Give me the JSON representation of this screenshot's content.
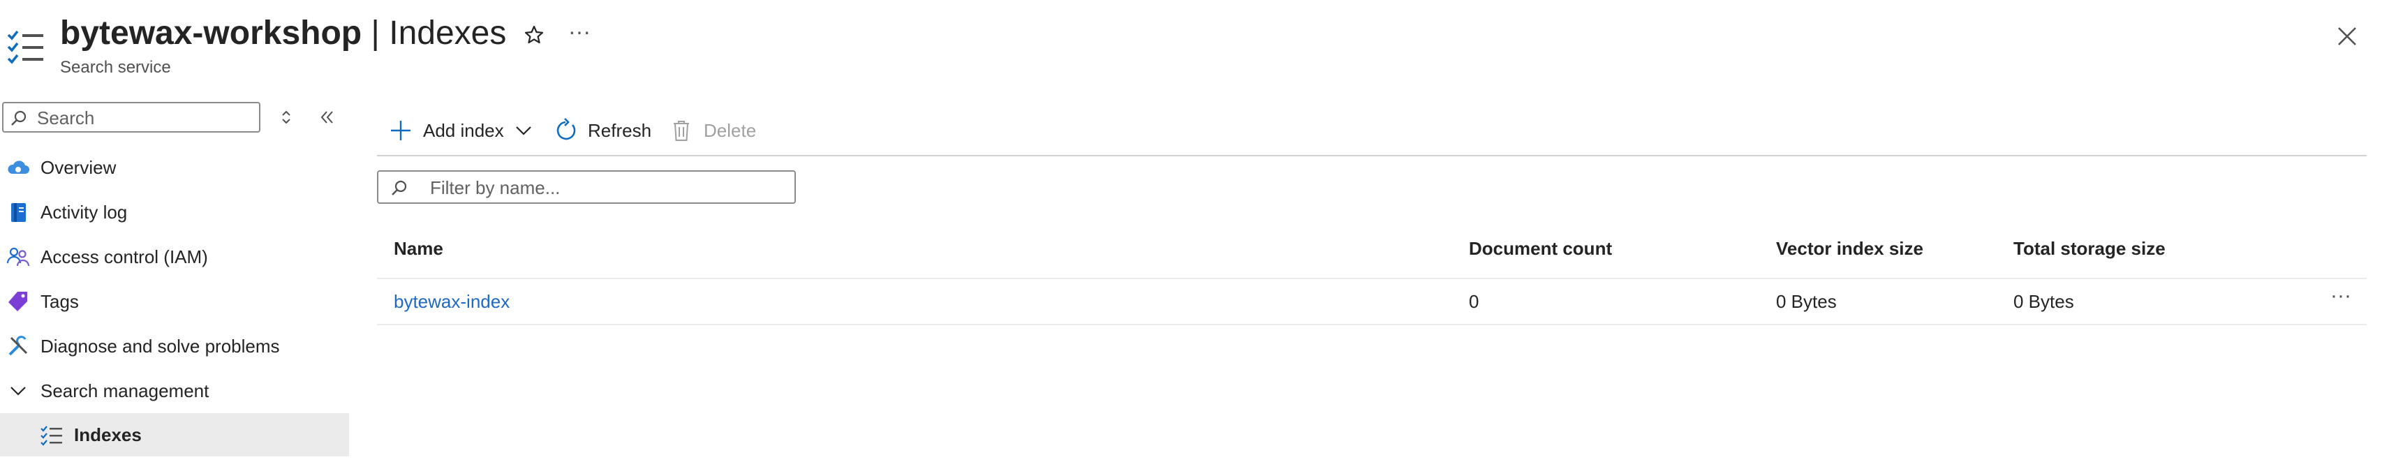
{
  "header": {
    "resource_name": "bytewax-workshop",
    "separator": " | ",
    "page_name": "Indexes",
    "subtitle": "Search service",
    "more_label": "···"
  },
  "sidebar": {
    "search_placeholder": "Search",
    "items": [
      {
        "label": "Overview",
        "icon": "cloud-overview-icon"
      },
      {
        "label": "Activity log",
        "icon": "activity-log-icon"
      },
      {
        "label": "Access control (IAM)",
        "icon": "people-icon"
      },
      {
        "label": "Tags",
        "icon": "tag-icon"
      },
      {
        "label": "Diagnose and solve problems",
        "icon": "wrench-icon"
      },
      {
        "label": "Search management",
        "icon": "chevron-down-icon"
      },
      {
        "label": "Indexes",
        "icon": "checklist-icon",
        "active": true
      }
    ]
  },
  "toolbar": {
    "add_index": "Add index",
    "refresh": "Refresh",
    "delete": "Delete"
  },
  "filter": {
    "placeholder": "Filter by name..."
  },
  "table": {
    "columns": [
      "Name",
      "Document count",
      "Vector index size",
      "Total storage size"
    ],
    "rows": [
      {
        "name": "bytewax-index",
        "document_count": "0",
        "vector_index_size": "0 Bytes",
        "total_storage_size": "0 Bytes",
        "more": "···"
      }
    ]
  },
  "colors": {
    "accent": "#0f6cbd",
    "link": "#1e69c2",
    "active_bg": "#ebebeb",
    "disabled": "#a0a0a0"
  }
}
